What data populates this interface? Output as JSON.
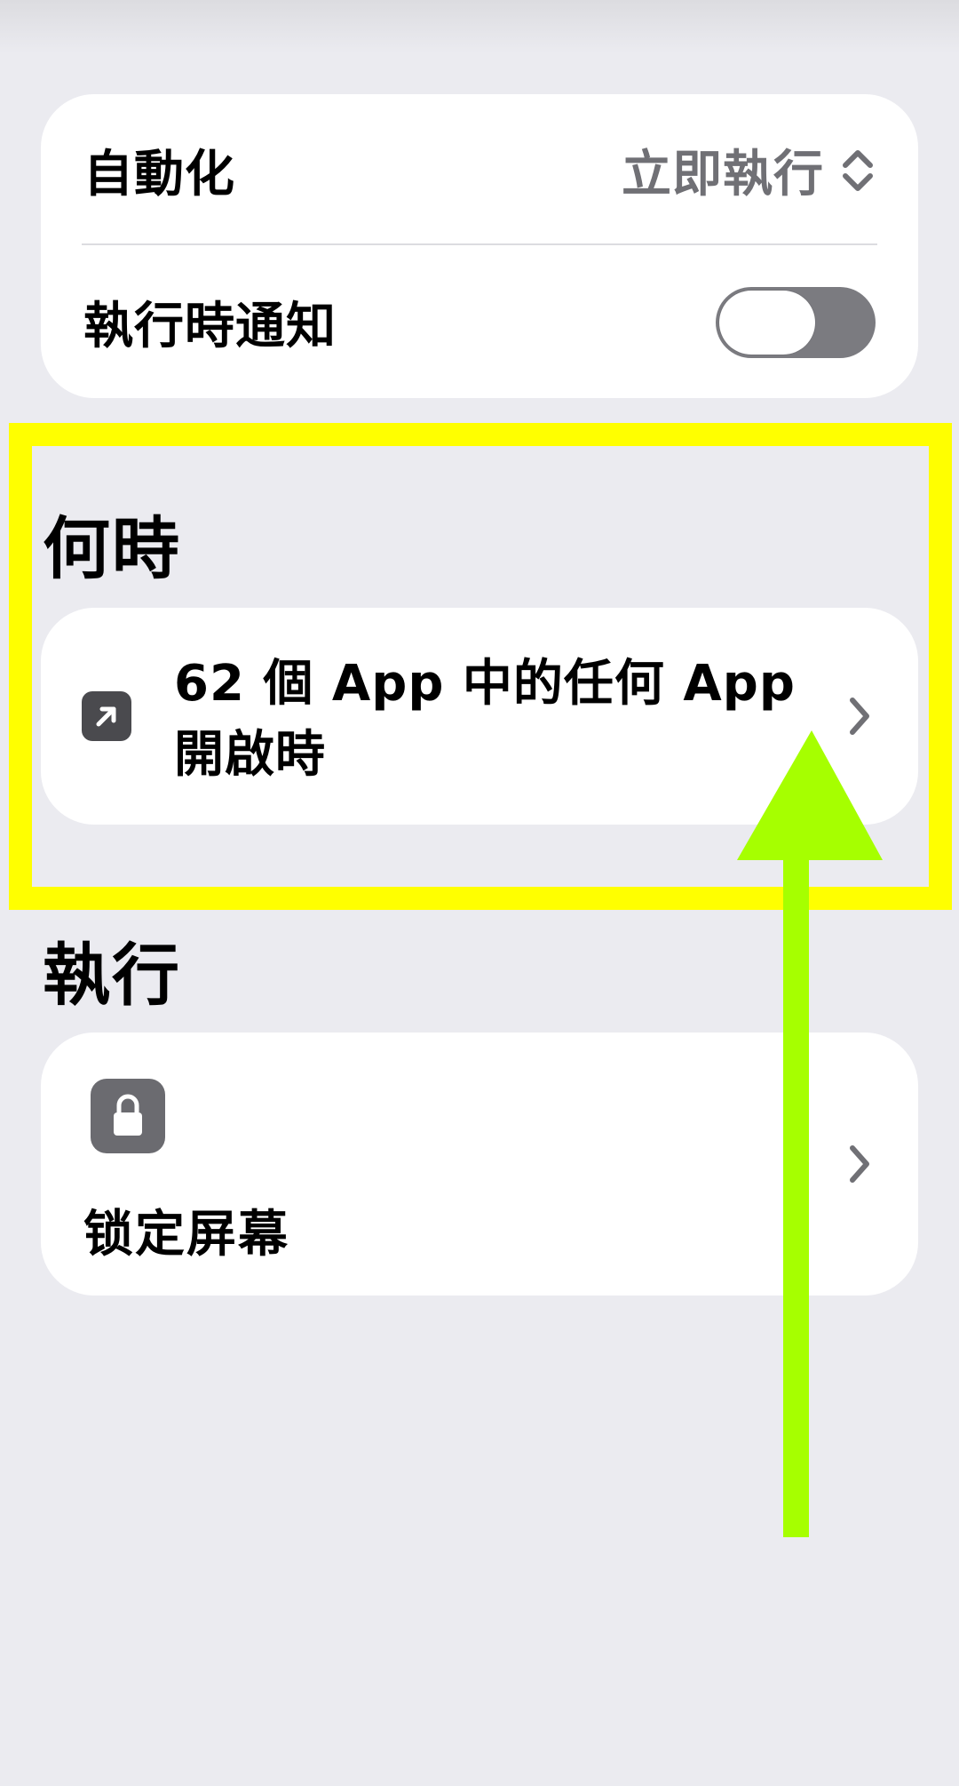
{
  "settings": {
    "automation_label": "自動化",
    "automation_value": "立即執行",
    "notify_label": "執行時通知",
    "notify_on": false
  },
  "when_section": {
    "title": "何時",
    "trigger_text": "62 個 App 中的任何 App 開啟時",
    "icon": "arrow-up-right-icon"
  },
  "do_section": {
    "title": "執行",
    "action_label": "锁定屏幕",
    "icon": "lock-icon"
  },
  "colors": {
    "background": "#ebebf0",
    "card": "#ffffff",
    "secondary_text": "#707075",
    "toggle_off": "#7b7b80",
    "highlight": "#ffff00",
    "arrow": "#a6ff00"
  }
}
